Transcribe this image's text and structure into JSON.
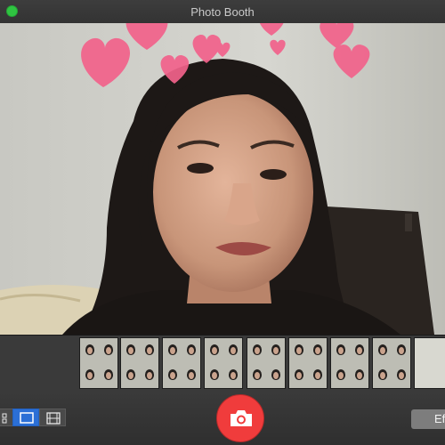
{
  "window": {
    "title": "Photo Booth"
  },
  "preview": {
    "effect": "hearts",
    "heart_color": "#f2628b"
  },
  "filmstrip": {
    "thumbnail_count": 9
  },
  "bottom": {
    "modes": [
      "four-up-icon",
      "single-photo-icon",
      "video-icon"
    ],
    "active_mode": "single-photo-icon",
    "effects_label": "Ef"
  },
  "colors": {
    "accent": "#2b6fd6",
    "shutter": "#f03c3c"
  }
}
